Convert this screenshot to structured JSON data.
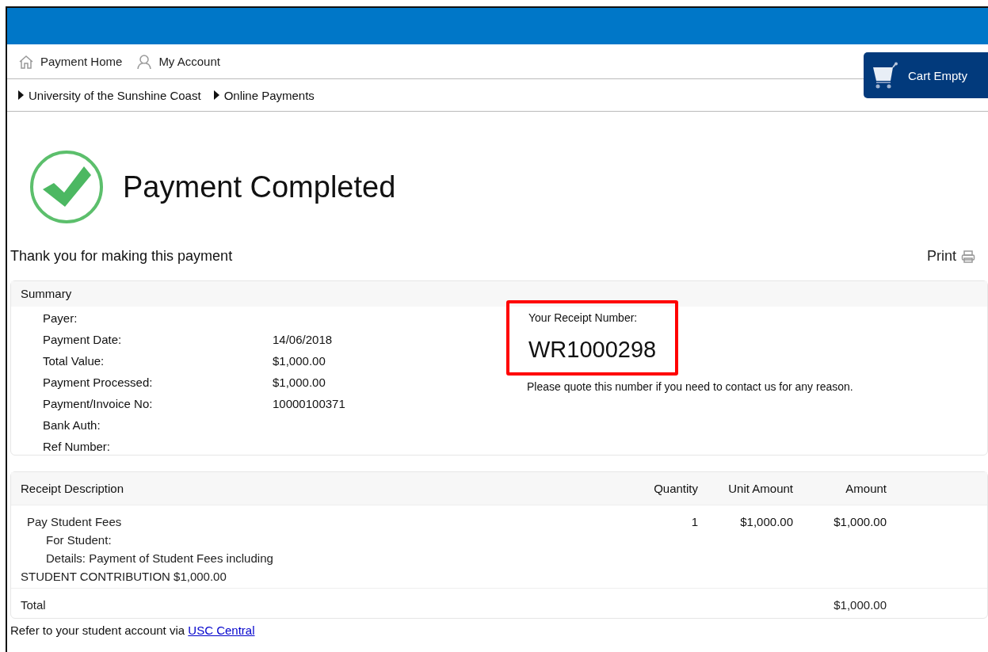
{
  "nav": {
    "items": [
      {
        "label": "Payment Home",
        "kind": "home"
      },
      {
        "label": "My Account",
        "kind": "account"
      }
    ]
  },
  "cart": {
    "label": "Cart Empty"
  },
  "breadcrumbs": [
    "University of the Sunshine Coast",
    "Online Payments"
  ],
  "heading": {
    "title": "Payment Completed"
  },
  "thanks": "Thank you for making this payment",
  "print": {
    "label": "Print"
  },
  "summary": {
    "title": "Summary",
    "fields": [
      {
        "label": "Payer:"
      },
      {
        "label": "Payment Date:",
        "value": "14/06/2018"
      },
      {
        "label": "Total Value:",
        "value": "$1,000.00"
      },
      {
        "label": "Payment Processed:",
        "value": "$1,000.00"
      },
      {
        "label": "Payment/Invoice No:",
        "value": "10000100371"
      },
      {
        "label": "Bank Auth:"
      },
      {
        "label": "Ref Number:"
      }
    ],
    "receipt": {
      "label": "Your Receipt Number:",
      "number": "WR1000298",
      "highlighted": true,
      "note": "Please quote this number if you need to contact us for any reason."
    }
  },
  "table": {
    "columns": [
      "Receipt Description",
      "Quantity",
      "Unit Amount",
      "Amount"
    ],
    "rows": [
      {
        "lines": [
          {
            "kind": "title",
            "text": "Pay Student Fees"
          },
          {
            "kind": "detail",
            "text": "For Student:"
          },
          {
            "kind": "detail",
            "text": "Details: Payment of Student Fees including"
          },
          {
            "kind": "wrap",
            "text": "STUDENT CONTRIBUTION $1,000.00"
          }
        ],
        "quantity": "1",
        "unit_amount": "$1,000.00",
        "amount": "$1,000.00"
      }
    ],
    "total": {
      "label": "Total",
      "amount": "$1,000.00"
    }
  },
  "footer": {
    "text": "Refer to your student account via",
    "link": "USC Central"
  }
}
